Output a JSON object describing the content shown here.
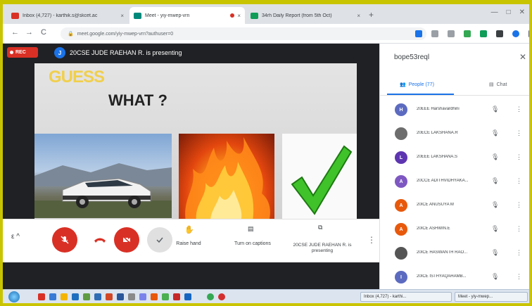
{
  "browser": {
    "tabs": [
      {
        "title": "Inbox (4,727) - karthik.s@skcet.ac",
        "close": "×",
        "favicon_color": "#d93025"
      },
      {
        "title": "Meet - yiy-mwep-vrn",
        "close": "×",
        "favicon_color": "#00897b"
      },
      {
        "title": "34rh Daily Report (from 5th Oct)",
        "close": "×",
        "favicon_color": "#0f9d58"
      }
    ],
    "new_tab": "+",
    "address": "meet.google.com/yiy-mwep-vrn?authuser=0",
    "nav": {
      "back": "←",
      "forward": "→",
      "reload": "C"
    },
    "window_buttons": {
      "minimize": "—",
      "maximize": "□",
      "close": "✕"
    }
  },
  "meet": {
    "rec_label": "REC",
    "presenter_initial": "J",
    "presenter_banner": "20CSE JUDE RAEHAN R. is presenting",
    "slide": {
      "heading": "GUESS",
      "subheading": "WHAT ?"
    },
    "controls": {
      "caret": "ε ^",
      "raise_hand_label": "Raise hand",
      "captions_label": "Turn on captions",
      "presenting_label": "20CSE JUDE RAEHAN R. is presenting",
      "more": "⋮"
    }
  },
  "panel": {
    "title": "bope53reql",
    "close": "✕",
    "tabs": {
      "people": "People (77)",
      "chat": "Chat"
    },
    "people": [
      {
        "initial": "H",
        "name": "20EEE Harshavardhini",
        "color": "#5c6bc0"
      },
      {
        "initial": "",
        "name": "20ECE LAKSHANA.R",
        "color": "#6d6d6d"
      },
      {
        "initial": "L",
        "name": "20EEE LAKSHANA.S",
        "color": "#5e35b1"
      },
      {
        "initial": "A",
        "name": "20CCE ADITHVIDHYAKA...",
        "color": "#7e57c2"
      },
      {
        "initial": "A",
        "name": "20ICE ANUSUYA M",
        "color": "#e8590c"
      },
      {
        "initial": "A",
        "name": "20ICE ASHWIN.E",
        "color": "#e8590c"
      },
      {
        "initial": "",
        "name": "20ICE HASWANTH RAO...",
        "color": "#555555"
      },
      {
        "initial": "I",
        "name": "20ICE ISTHYAQAHAMB...",
        "color": "#5c6bc0"
      }
    ]
  },
  "taskbar": {
    "windows": [
      {
        "title": "Inbox (4,727) - karthi..."
      },
      {
        "title": "Meet - yiy-mwep..."
      }
    ]
  }
}
